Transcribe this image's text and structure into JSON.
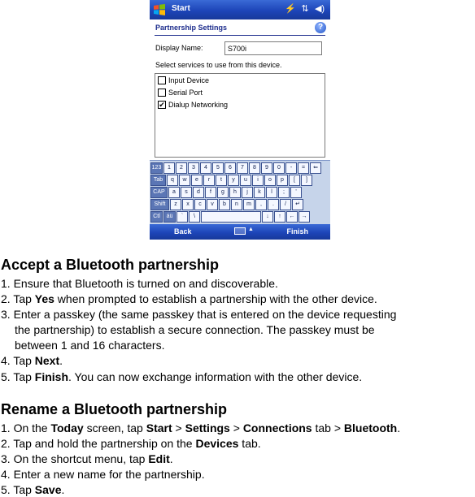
{
  "device": {
    "titlebar": {
      "start_label": "Start",
      "tray_icons": [
        "bluetooth-connectivity-icon",
        "signal-icon",
        "volume-icon"
      ]
    },
    "page_title": "Partnership Settings",
    "display_name_label": "Display Name:",
    "display_name_value": "S700i",
    "services_prompt": "Select services to use from this device.",
    "services": [
      {
        "label": "Input Device",
        "checked": false
      },
      {
        "label": "Serial Port",
        "checked": false
      },
      {
        "label": "Dialup Networking",
        "checked": true
      }
    ],
    "keyboard_rows": [
      [
        "123",
        "1",
        "2",
        "3",
        "4",
        "5",
        "6",
        "7",
        "8",
        "9",
        "0",
        "-",
        "=",
        "⇐"
      ],
      [
        "Tab",
        "q",
        "w",
        "e",
        "r",
        "t",
        "y",
        "u",
        "i",
        "o",
        "p",
        "[",
        "]"
      ],
      [
        "CAP",
        "a",
        "s",
        "d",
        "f",
        "g",
        "h",
        "j",
        "k",
        "l",
        ";",
        "'"
      ],
      [
        "Shift",
        "z",
        "x",
        "c",
        "v",
        "b",
        "n",
        "m",
        ",",
        ".",
        "/",
        "↵"
      ],
      [
        "Ctl",
        "áü",
        "`",
        "\\",
        " ",
        "↓",
        "↑",
        "←",
        "→"
      ]
    ],
    "softkeys": {
      "left": "Back",
      "right": "Finish"
    }
  },
  "section1": {
    "heading": "Accept a Bluetooth partnership",
    "steps": {
      "s1": "1. Ensure that Bluetooth is turned on and discoverable.",
      "s2_pre": "2. Tap ",
      "s2_bold": "Yes",
      "s2_post": " when prompted to establish a partnership with the other device.",
      "s3_line1": "3. Enter a passkey (the same passkey that is entered on the device requesting",
      "s3_line2": "the partnership) to establish a secure connection. The passkey must be",
      "s3_line3": "between 1 and 16 characters.",
      "s4_pre": "4. Tap ",
      "s4_bold": "Next",
      "s4_post": ".",
      "s5_pre": "5. Tap ",
      "s5_bold": "Finish",
      "s5_post": ". You can now exchange information with the other device."
    }
  },
  "section2": {
    "heading": "Rename a Bluetooth partnership",
    "steps": {
      "s1_pre": "1. On the ",
      "s1_b1": "Today",
      "s1_m1": " screen, tap ",
      "s1_b2": "Start",
      "s1_m2": " > ",
      "s1_b3": "Settings",
      "s1_m3": " > ",
      "s1_b4": "Connections",
      "s1_m4": " tab > ",
      "s1_b5": "Bluetooth",
      "s1_post": ".",
      "s2_pre": "2. Tap and hold the partnership on the ",
      "s2_bold": "Devices",
      "s2_post": " tab.",
      "s3_pre": "3. On the shortcut menu, tap ",
      "s3_bold": "Edit",
      "s3_post": ".",
      "s4": "4. Enter a new name for the partnership.",
      "s5_pre": "5. Tap ",
      "s5_bold": "Save",
      "s5_post": "."
    }
  }
}
